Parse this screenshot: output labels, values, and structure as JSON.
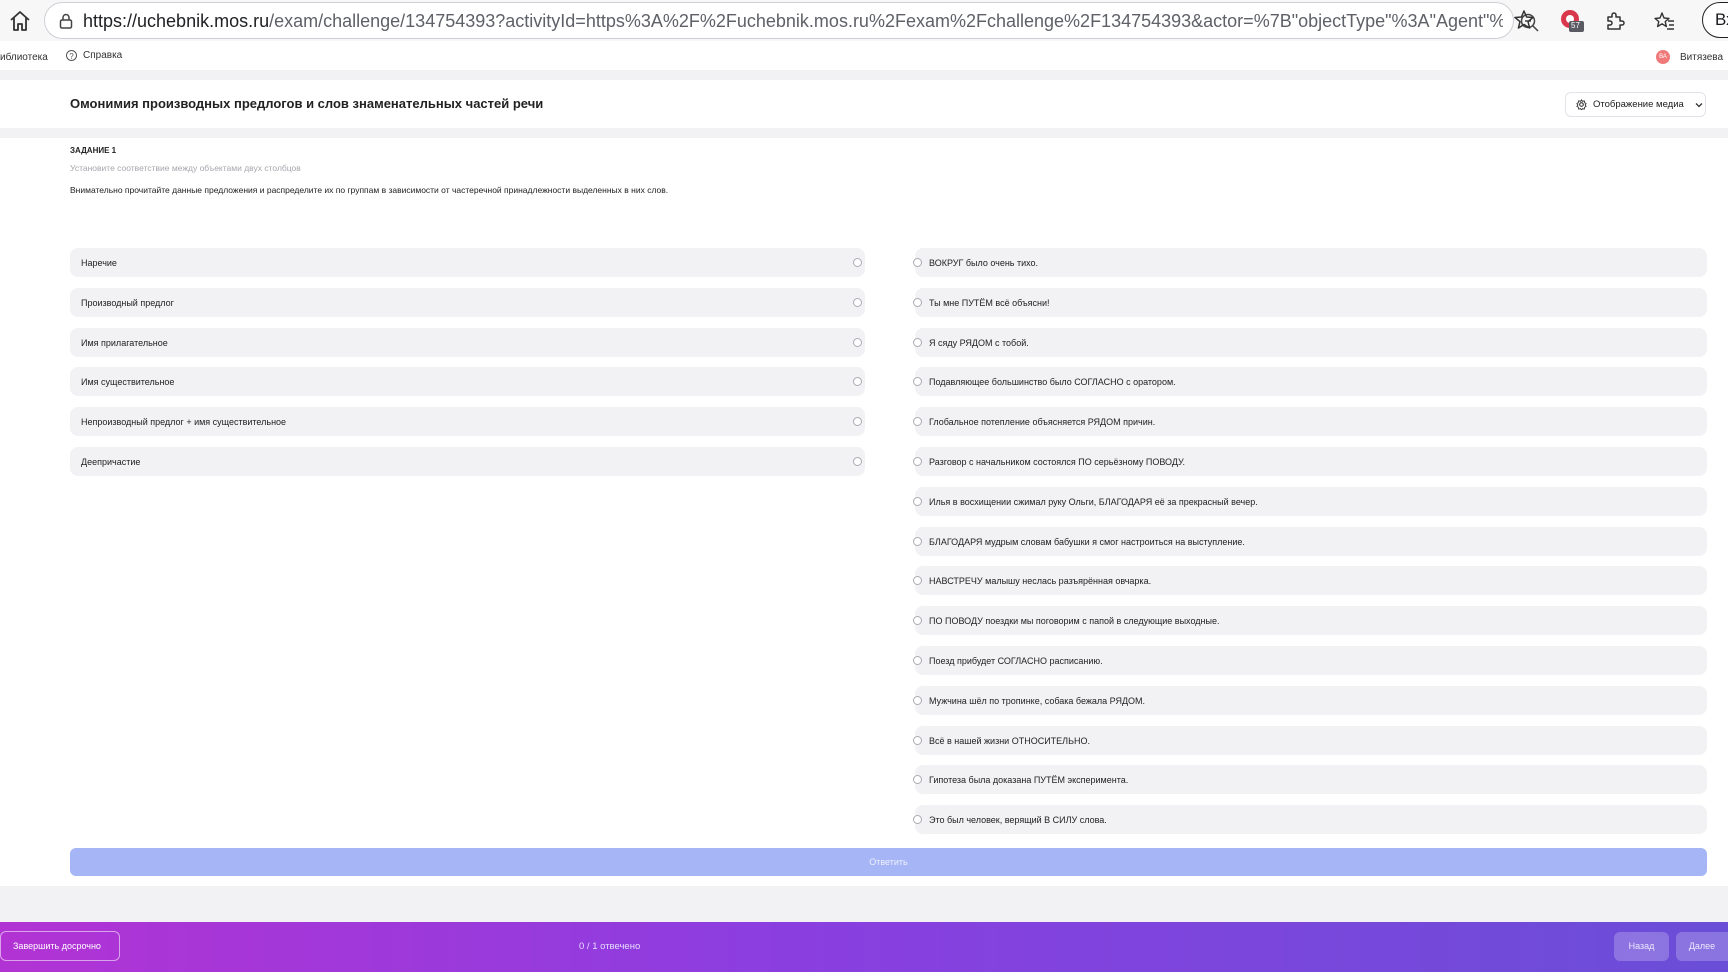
{
  "browser": {
    "url_host": "https://uchebnik.mos.ru",
    "url_path": "/exam/challenge/134754393?activityId=https%3A%2F%2Fuchebnik.mos.ru%2Fexam%2Fchallenge%2F134754393&actor=%7B\"objectType\"%3A\"Agent\"%...",
    "extension_badge": "57",
    "login_label": "Вход"
  },
  "appbar": {
    "library_label": "иблиотека",
    "help_label": "Справка",
    "avatar_initials": "ВА",
    "user_name": "Витязева"
  },
  "header": {
    "title": "Омонимия производных предлогов и слов знаменательных частей речи",
    "media_button": "Отображение медиа"
  },
  "task": {
    "label": "ЗАДАНИЕ 1",
    "hint": "Установите соответствие между объектами двух столбцов",
    "instruction": "Внимательно прочитайте данные предложения и распределите их по группам в зависимости от частеречной принадлежности выделенных в них слов.",
    "left_items": [
      "Наречие",
      "Производный предлог",
      "Имя прилагательное",
      "Имя существительное",
      "Непроизводный предлог + имя существительное",
      "Деепричастие"
    ],
    "right_items": [
      "ВОКРУГ было очень тихо.",
      "Ты мне ПУТЁМ всё объясни!",
      "Я сяду РЯДОМ с тобой.",
      "Подавляющее большинство было СОГЛАСНО с оратором.",
      "Глобальное потепление объясняется РЯДОМ причин.",
      "Разговор с начальником состоялся ПО серьёзному ПОВОДУ.",
      "Илья в восхищении сжимал руку Ольги, БЛАГОДАРЯ её за прекрасный вечер.",
      "БЛАГОДАРЯ мудрым словам бабушки я смог настроиться на выступление.",
      "НАВСТРЕЧУ малышу неслась разъярённая овчарка.",
      "ПО ПОВОДУ поездки мы поговорим с папой в следующие выходные.",
      "Поезд прибудет СОГЛАСНО расписанию.",
      "Мужчина шёл по тропинке, собака бежала РЯДОМ.",
      "Всё в нашей жизни ОТНОСИТЕЛЬНО.",
      "Гипотеза была доказана ПУТЁМ эксперимента.",
      "Это был человек, верящий В СИЛУ слова."
    ],
    "answer_button": "Ответить"
  },
  "footer": {
    "finish_button": "Завершить досрочно",
    "progress": "0 / 1 отвечено",
    "back_button": "Назад",
    "next_button": "Далее"
  },
  "colors": {
    "footer_gradient_start": "#b233d4",
    "footer_gradient_end": "#6a4ed8",
    "answer_button_bg": "#a6b5f5",
    "item_bg": "#f2f2f5"
  }
}
